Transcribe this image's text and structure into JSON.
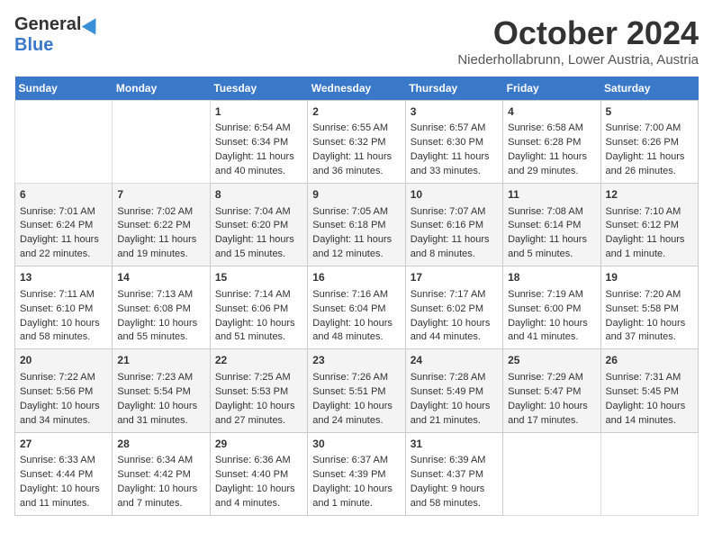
{
  "header": {
    "logo_line1": "General",
    "logo_line2": "Blue",
    "month_title": "October 2024",
    "location": "Niederhollabrunn, Lower Austria, Austria"
  },
  "days_of_week": [
    "Sunday",
    "Monday",
    "Tuesday",
    "Wednesday",
    "Thursday",
    "Friday",
    "Saturday"
  ],
  "weeks": [
    [
      {
        "day": "",
        "sunrise": "",
        "sunset": "",
        "daylight": ""
      },
      {
        "day": "",
        "sunrise": "",
        "sunset": "",
        "daylight": ""
      },
      {
        "day": "1",
        "sunrise": "Sunrise: 6:54 AM",
        "sunset": "Sunset: 6:34 PM",
        "daylight": "Daylight: 11 hours and 40 minutes."
      },
      {
        "day": "2",
        "sunrise": "Sunrise: 6:55 AM",
        "sunset": "Sunset: 6:32 PM",
        "daylight": "Daylight: 11 hours and 36 minutes."
      },
      {
        "day": "3",
        "sunrise": "Sunrise: 6:57 AM",
        "sunset": "Sunset: 6:30 PM",
        "daylight": "Daylight: 11 hours and 33 minutes."
      },
      {
        "day": "4",
        "sunrise": "Sunrise: 6:58 AM",
        "sunset": "Sunset: 6:28 PM",
        "daylight": "Daylight: 11 hours and 29 minutes."
      },
      {
        "day": "5",
        "sunrise": "Sunrise: 7:00 AM",
        "sunset": "Sunset: 6:26 PM",
        "daylight": "Daylight: 11 hours and 26 minutes."
      }
    ],
    [
      {
        "day": "6",
        "sunrise": "Sunrise: 7:01 AM",
        "sunset": "Sunset: 6:24 PM",
        "daylight": "Daylight: 11 hours and 22 minutes."
      },
      {
        "day": "7",
        "sunrise": "Sunrise: 7:02 AM",
        "sunset": "Sunset: 6:22 PM",
        "daylight": "Daylight: 11 hours and 19 minutes."
      },
      {
        "day": "8",
        "sunrise": "Sunrise: 7:04 AM",
        "sunset": "Sunset: 6:20 PM",
        "daylight": "Daylight: 11 hours and 15 minutes."
      },
      {
        "day": "9",
        "sunrise": "Sunrise: 7:05 AM",
        "sunset": "Sunset: 6:18 PM",
        "daylight": "Daylight: 11 hours and 12 minutes."
      },
      {
        "day": "10",
        "sunrise": "Sunrise: 7:07 AM",
        "sunset": "Sunset: 6:16 PM",
        "daylight": "Daylight: 11 hours and 8 minutes."
      },
      {
        "day": "11",
        "sunrise": "Sunrise: 7:08 AM",
        "sunset": "Sunset: 6:14 PM",
        "daylight": "Daylight: 11 hours and 5 minutes."
      },
      {
        "day": "12",
        "sunrise": "Sunrise: 7:10 AM",
        "sunset": "Sunset: 6:12 PM",
        "daylight": "Daylight: 11 hours and 1 minute."
      }
    ],
    [
      {
        "day": "13",
        "sunrise": "Sunrise: 7:11 AM",
        "sunset": "Sunset: 6:10 PM",
        "daylight": "Daylight: 10 hours and 58 minutes."
      },
      {
        "day": "14",
        "sunrise": "Sunrise: 7:13 AM",
        "sunset": "Sunset: 6:08 PM",
        "daylight": "Daylight: 10 hours and 55 minutes."
      },
      {
        "day": "15",
        "sunrise": "Sunrise: 7:14 AM",
        "sunset": "Sunset: 6:06 PM",
        "daylight": "Daylight: 10 hours and 51 minutes."
      },
      {
        "day": "16",
        "sunrise": "Sunrise: 7:16 AM",
        "sunset": "Sunset: 6:04 PM",
        "daylight": "Daylight: 10 hours and 48 minutes."
      },
      {
        "day": "17",
        "sunrise": "Sunrise: 7:17 AM",
        "sunset": "Sunset: 6:02 PM",
        "daylight": "Daylight: 10 hours and 44 minutes."
      },
      {
        "day": "18",
        "sunrise": "Sunrise: 7:19 AM",
        "sunset": "Sunset: 6:00 PM",
        "daylight": "Daylight: 10 hours and 41 minutes."
      },
      {
        "day": "19",
        "sunrise": "Sunrise: 7:20 AM",
        "sunset": "Sunset: 5:58 PM",
        "daylight": "Daylight: 10 hours and 37 minutes."
      }
    ],
    [
      {
        "day": "20",
        "sunrise": "Sunrise: 7:22 AM",
        "sunset": "Sunset: 5:56 PM",
        "daylight": "Daylight: 10 hours and 34 minutes."
      },
      {
        "day": "21",
        "sunrise": "Sunrise: 7:23 AM",
        "sunset": "Sunset: 5:54 PM",
        "daylight": "Daylight: 10 hours and 31 minutes."
      },
      {
        "day": "22",
        "sunrise": "Sunrise: 7:25 AM",
        "sunset": "Sunset: 5:53 PM",
        "daylight": "Daylight: 10 hours and 27 minutes."
      },
      {
        "day": "23",
        "sunrise": "Sunrise: 7:26 AM",
        "sunset": "Sunset: 5:51 PM",
        "daylight": "Daylight: 10 hours and 24 minutes."
      },
      {
        "day": "24",
        "sunrise": "Sunrise: 7:28 AM",
        "sunset": "Sunset: 5:49 PM",
        "daylight": "Daylight: 10 hours and 21 minutes."
      },
      {
        "day": "25",
        "sunrise": "Sunrise: 7:29 AM",
        "sunset": "Sunset: 5:47 PM",
        "daylight": "Daylight: 10 hours and 17 minutes."
      },
      {
        "day": "26",
        "sunrise": "Sunrise: 7:31 AM",
        "sunset": "Sunset: 5:45 PM",
        "daylight": "Daylight: 10 hours and 14 minutes."
      }
    ],
    [
      {
        "day": "27",
        "sunrise": "Sunrise: 6:33 AM",
        "sunset": "Sunset: 4:44 PM",
        "daylight": "Daylight: 10 hours and 11 minutes."
      },
      {
        "day": "28",
        "sunrise": "Sunrise: 6:34 AM",
        "sunset": "Sunset: 4:42 PM",
        "daylight": "Daylight: 10 hours and 7 minutes."
      },
      {
        "day": "29",
        "sunrise": "Sunrise: 6:36 AM",
        "sunset": "Sunset: 4:40 PM",
        "daylight": "Daylight: 10 hours and 4 minutes."
      },
      {
        "day": "30",
        "sunrise": "Sunrise: 6:37 AM",
        "sunset": "Sunset: 4:39 PM",
        "daylight": "Daylight: 10 hours and 1 minute."
      },
      {
        "day": "31",
        "sunrise": "Sunrise: 6:39 AM",
        "sunset": "Sunset: 4:37 PM",
        "daylight": "Daylight: 9 hours and 58 minutes."
      },
      {
        "day": "",
        "sunrise": "",
        "sunset": "",
        "daylight": ""
      },
      {
        "day": "",
        "sunrise": "",
        "sunset": "",
        "daylight": ""
      }
    ]
  ]
}
